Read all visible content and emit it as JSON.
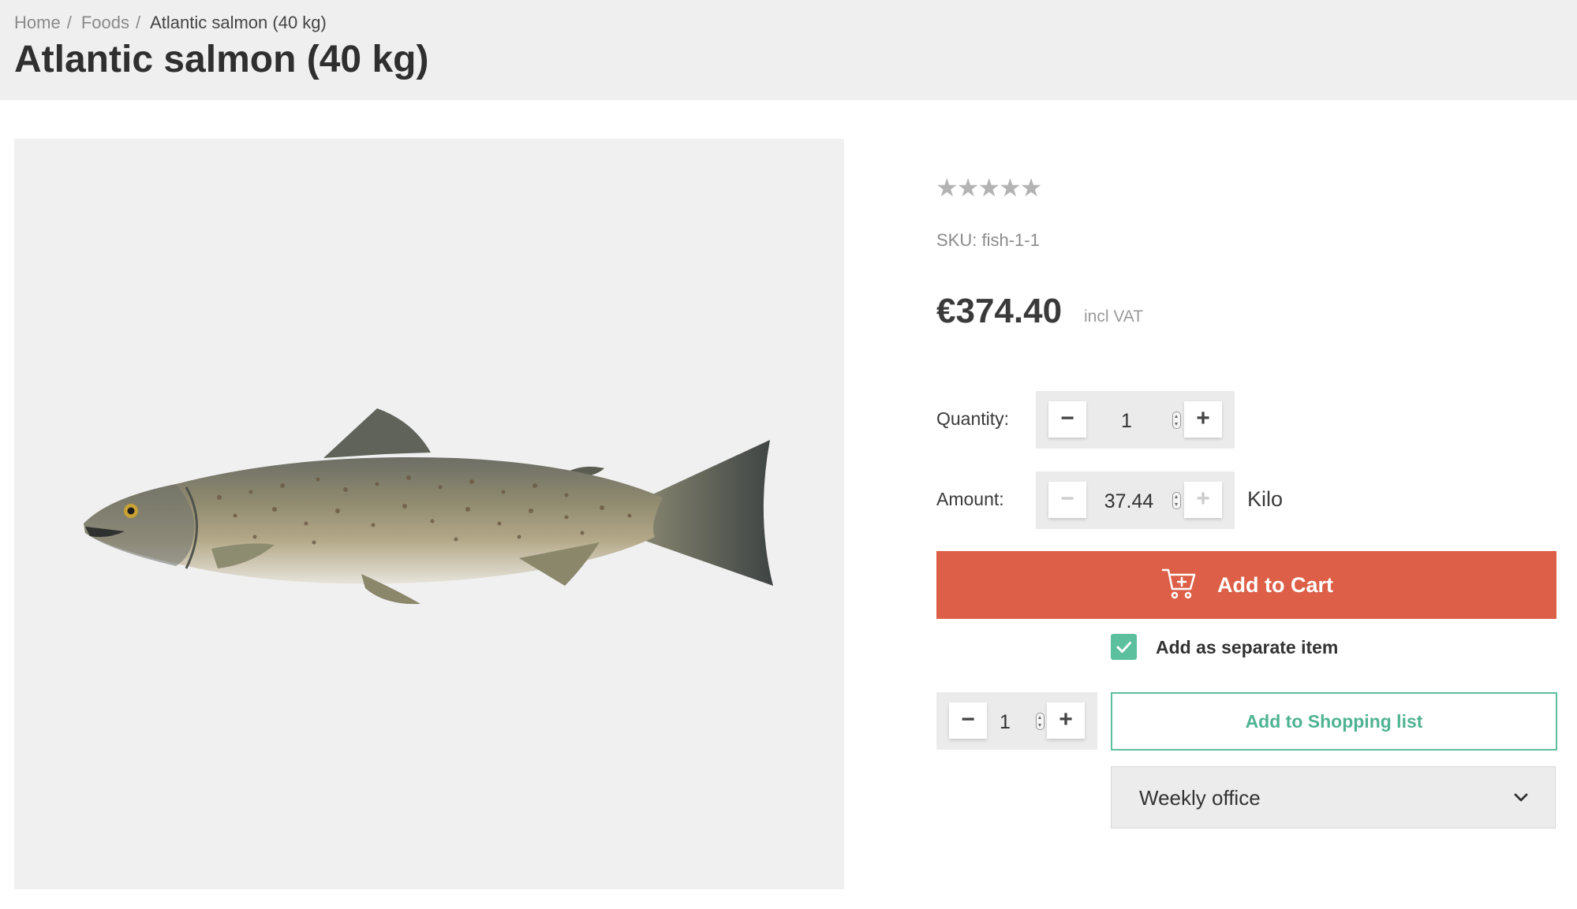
{
  "breadcrumb": {
    "items": [
      "Home",
      "Foods",
      "Atlantic salmon (40 kg)"
    ],
    "separator": "/"
  },
  "page_title": "Atlantic salmon (40 kg)",
  "product_image": {
    "icon": "salmon-illustration"
  },
  "rating": {
    "stars": [
      "★",
      "★",
      "★",
      "★",
      "★"
    ],
    "value": 0,
    "max": 5
  },
  "sku": "SKU: fish-1-1",
  "price": {
    "amount": "€374.40",
    "vat_note": "incl VAT"
  },
  "quantity": {
    "label": "Quantity:",
    "value": "1",
    "minus": "−",
    "plus": "+"
  },
  "amount": {
    "label": "Amount:",
    "value": "37.44",
    "unit": "Kilo",
    "minus": "−",
    "plus": "+"
  },
  "add_to_cart": {
    "label": "Add to Cart",
    "icon": "cart-plus-icon",
    "color": "#dd5f47"
  },
  "separate_item": {
    "label": "Add as separate item",
    "checked": true,
    "color": "#5cbf9e"
  },
  "shopping_list": {
    "quantity": "1",
    "minus": "−",
    "plus": "+",
    "button_label": "Add to Shopping list",
    "selected_list": "Weekly office"
  }
}
